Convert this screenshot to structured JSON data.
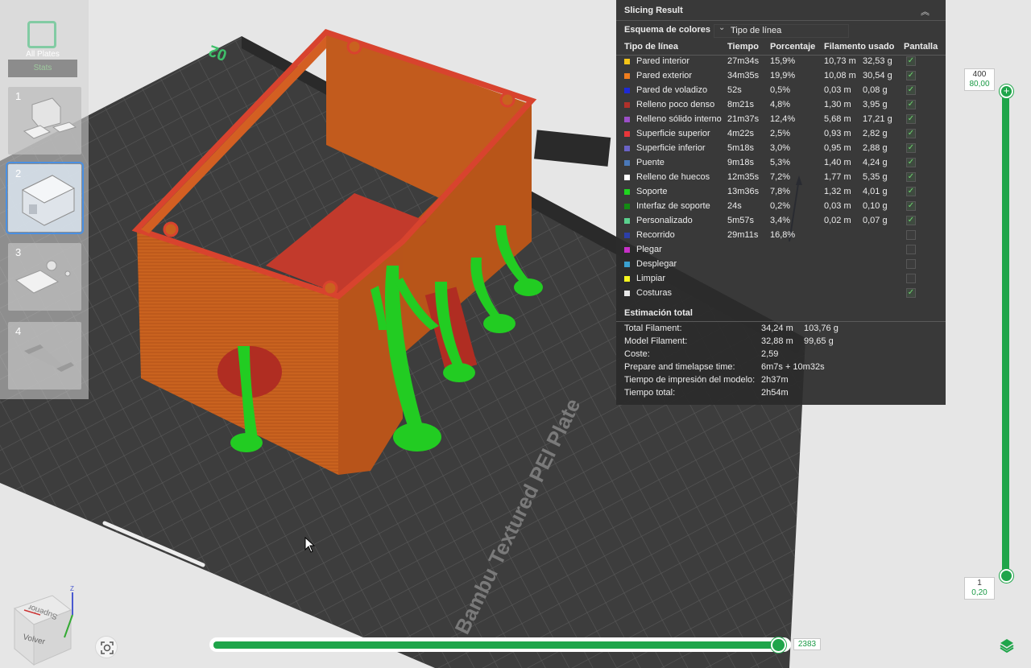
{
  "plates": {
    "all_label": "All Plates",
    "all_stats": "Stats",
    "items": [
      {
        "number": "1"
      },
      {
        "number": "2"
      },
      {
        "number": "3"
      },
      {
        "number": "4"
      }
    ]
  },
  "viewport": {
    "plate_number": "02",
    "plate_brand": "Bambu Textured PEI Plate"
  },
  "panel": {
    "title": "Slicing Result",
    "scheme_label": "Esquema de colores",
    "scheme_value": "Tipo de línea",
    "headers": {
      "type": "Tipo de línea",
      "time": "Tiempo",
      "percent": "Porcentaje",
      "filament": "Filamento usado",
      "display": "Pantalla"
    },
    "rows": [
      {
        "color": "#f5c518",
        "name": "Pared interior",
        "time": "27m34s",
        "pct": "15,9%",
        "len": "10,73 m",
        "weight": "32,53 g",
        "shown": true
      },
      {
        "color": "#ef7d1e",
        "name": "Pared exterior",
        "time": "34m35s",
        "pct": "19,9%",
        "len": "10,08 m",
        "weight": "30,54 g",
        "shown": true
      },
      {
        "color": "#1e2ad6",
        "name": "Pared de voladizo",
        "time": "52s",
        "pct": "0,5%",
        "len": "0,03 m",
        "weight": "0,08 g",
        "shown": true
      },
      {
        "color": "#b0302a",
        "name": "Relleno poco denso",
        "time": "8m21s",
        "pct": "4,8%",
        "len": "1,30 m",
        "weight": "3,95 g",
        "shown": true
      },
      {
        "color": "#9b4fc7",
        "name": "Relleno sólido interno",
        "time": "21m37s",
        "pct": "12,4%",
        "len": "5,68 m",
        "weight": "17,21 g",
        "shown": true
      },
      {
        "color": "#e8363a",
        "name": "Superficie superior",
        "time": "4m22s",
        "pct": "2,5%",
        "len": "0,93 m",
        "weight": "2,82 g",
        "shown": true
      },
      {
        "color": "#6a63c6",
        "name": "Superficie inferior",
        "time": "5m18s",
        "pct": "3,0%",
        "len": "0,95 m",
        "weight": "2,88 g",
        "shown": true
      },
      {
        "color": "#4a78b8",
        "name": "Puente",
        "time": "9m18s",
        "pct": "5,3%",
        "len": "1,40 m",
        "weight": "4,24 g",
        "shown": true
      },
      {
        "color": "#ffffff",
        "name": "Relleno de huecos",
        "time": "12m35s",
        "pct": "7,2%",
        "len": "1,77 m",
        "weight": "5,35 g",
        "shown": true
      },
      {
        "color": "#1fd41f",
        "name": "Soporte",
        "time": "13m36s",
        "pct": "7,8%",
        "len": "1,32 m",
        "weight": "4,01 g",
        "shown": true
      },
      {
        "color": "#138a13",
        "name": "Interfaz de soporte",
        "time": "24s",
        "pct": "0,2%",
        "len": "0,03 m",
        "weight": "0,10 g",
        "shown": true
      },
      {
        "color": "#5ad18e",
        "name": "Personalizado",
        "time": "5m57s",
        "pct": "3,4%",
        "len": "0,02 m",
        "weight": "0,07 g",
        "shown": true
      },
      {
        "color": "#2c3fa8",
        "name": "Recorrido",
        "time": "29m11s",
        "pct": "16,8%",
        "len": "",
        "weight": "",
        "shown": false
      },
      {
        "color": "#c730c7",
        "name": "Plegar",
        "time": "",
        "pct": "",
        "len": "",
        "weight": "",
        "shown": false
      },
      {
        "color": "#3aa0d0",
        "name": "Desplegar",
        "time": "",
        "pct": "",
        "len": "",
        "weight": "",
        "shown": false
      },
      {
        "color": "#f5f51f",
        "name": "Limpiar",
        "time": "",
        "pct": "",
        "len": "",
        "weight": "",
        "shown": false
      },
      {
        "color": "#e8e8e8",
        "name": "Costuras",
        "time": "",
        "pct": "",
        "len": "",
        "weight": "",
        "shown": true
      }
    ],
    "estimate_title": "Estimación total",
    "estimates": [
      {
        "label": "Total Filament:",
        "v1": "34,24 m",
        "v2": "103,76 g"
      },
      {
        "label": "Model Filament:",
        "v1": "32,88 m",
        "v2": "99,65 g"
      },
      {
        "label": "Coste:",
        "v1": "2,59",
        "v2": ""
      },
      {
        "label": "Prepare and timelapse time:",
        "v1": "6m7s + 10m32s",
        "v2": ""
      },
      {
        "label": "Tiempo de impresión del modelo:",
        "v1": "2h37m",
        "v2": ""
      },
      {
        "label": "Tiempo total:",
        "v1": "2h54m",
        "v2": ""
      }
    ]
  },
  "layer_slider": {
    "top_layer": "400",
    "top_height": "80,00",
    "bottom_layer": "1",
    "bottom_height": "0,20"
  },
  "move_slider": {
    "value": "2383",
    "progress": 1.0
  },
  "nav_cube": {
    "top_label": "Superior",
    "front_label": "Volver",
    "axis_z": "Z"
  },
  "colors": {
    "accent": "#1fa54a",
    "wall": "#c9621f",
    "support": "#22cc22"
  }
}
